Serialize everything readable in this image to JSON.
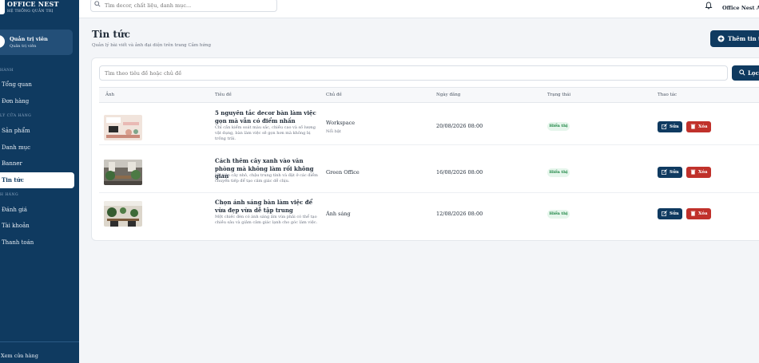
{
  "brand": {
    "name": "OFFICE NEST",
    "subtitle": "HỆ THỐNG QUẢN TRỊ"
  },
  "profile": {
    "name": "Quản trị viên",
    "role": "Quản trị viên"
  },
  "sidebar": {
    "sections": [
      {
        "label": "HÀNH"
      },
      {
        "label": "LÝ CỬA HÀNG"
      },
      {
        "label": "H HÀNG"
      }
    ],
    "items": [
      {
        "label": "Tổng quan"
      },
      {
        "label": "Đơn hàng"
      },
      {
        "label": "Sản phẩm"
      },
      {
        "label": "Danh mục"
      },
      {
        "label": "Banner"
      },
      {
        "label": "Tin tức"
      },
      {
        "label": "Đánh giá"
      },
      {
        "label": "Tài khoản"
      },
      {
        "label": "Thanh toán"
      }
    ],
    "active": "Tin tức",
    "footer": "Xem cửa hàng"
  },
  "topbar": {
    "search_placeholder": "Tìm decor, chất liệu, danh mục...",
    "admin_name": "Office Nest A"
  },
  "header": {
    "title": "Tin tức",
    "description": "Quản lý bài viết và ảnh đại diện trên trang Cảm hứng",
    "add_label": "Thêm tin tứ"
  },
  "filter": {
    "placeholder": "Tìm theo tiêu đề hoặc chủ đề",
    "button_label": "Lọc"
  },
  "table": {
    "columns": [
      "Ảnh",
      "Tiêu đề",
      "Chủ đề",
      "Ngày đăng",
      "Trạng thái",
      "Thao tác"
    ],
    "rows": [
      {
        "title": "5 nguyên tắc decor bàn làm việc gọn mà vẫn có điểm nhấn",
        "excerpt": "Chỉ cần kiểm soát màu sắc, chiều cao và số lượng vật dụng, bàn làm việc sẽ gọn hơn mà không bị trống trải.",
        "category": "Workspace",
        "tag": "Nổi bật",
        "date": "20/08/2026 08:00",
        "status": "Hiển thị",
        "edit": "Sửa",
        "delete": "Xóa"
      },
      {
        "title": "Cách thêm cây xanh vào văn phòng mà không làm rối không gian",
        "excerpt": "Ưu tiên cây nhỏ, chậu trung tính và đặt ở các điểm chuyển tiếp để tạo cảm giác dễ chịu.",
        "category": "Green Office",
        "tag": "",
        "date": "16/08/2026 08:00",
        "status": "Hiển thị",
        "edit": "Sửa",
        "delete": "Xóa"
      },
      {
        "title": "Chọn ánh sáng bàn làm việc để vừa đẹp vừa dễ tập trung",
        "excerpt": "Một chiếc đèn có ánh sáng ấm vừa phải có thể tạo chiều sâu và giảm cảm giác lạnh cho góc làm việc.",
        "category": "Ánh sáng",
        "tag": "",
        "date": "12/08/2026 08:00",
        "status": "Hiển thị",
        "edit": "Sửa",
        "delete": "Xóa"
      }
    ]
  },
  "colors": {
    "sidebar": "#0f3a60",
    "primary": "#0f3a60",
    "danger": "#c0312b",
    "success_bg": "#e6f6ec",
    "success_text": "#15803d"
  }
}
